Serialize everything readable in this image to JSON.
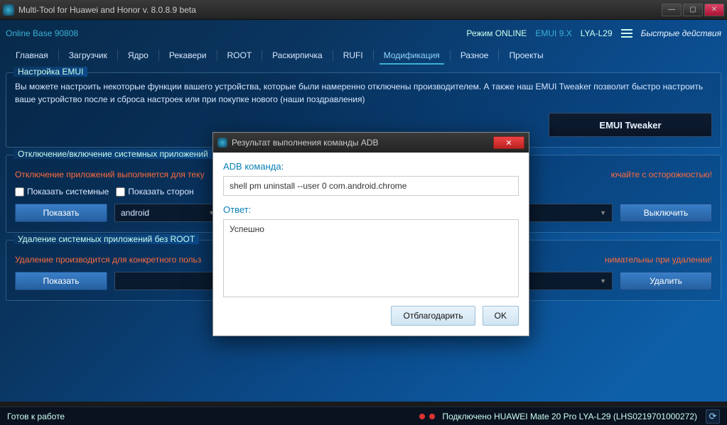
{
  "window": {
    "title": "Multi-Tool for Huawei and Honor v. 8.0.8.9 beta"
  },
  "header": {
    "online_base": "Online Base 90808",
    "mode_label": "Режим ONLINE",
    "emui": "EMUI 9.X",
    "device_short": "LYA-L29",
    "quick_actions": "Быстрые действия"
  },
  "tabs": [
    "Главная",
    "Загрузчик",
    "Ядро",
    "Рекавери",
    "ROOT",
    "Раскирпичка",
    "RUFI",
    "Модификация",
    "Разное",
    "Проекты"
  ],
  "active_tab_index": 7,
  "emui_panel": {
    "title": "Настройка EMUI",
    "desc": "Вы можете настроить некоторые функции вашего устройства, которые были намеренно отключены производителем. А также наш EMUI Tweaker позволит быстро настроить ваше устройство после и сброса настроек или при покупке нового (наши поздравления)",
    "tweaker_btn": "EMUI Tweaker"
  },
  "apps_panel": {
    "title": "Отключение/включение системных приложений",
    "warn_left": "Отключение приложений выполняется для теку",
    "warn_right": "ючайте с осторожностью!",
    "chk_system": "Показать системные",
    "chk_third": "Показать сторон",
    "btn_show": "Показать",
    "combo_value": "android",
    "btn_disable": "Выключить"
  },
  "delete_panel": {
    "title": "Удаление системных приложений без ROOT",
    "warn_left": "Удаление производится для конкретного польз",
    "warn_right": "нимательны при удалении!",
    "btn_show": "Показать",
    "btn_delete": "Удалить"
  },
  "status": {
    "ready": "Готов к работе",
    "connected": "Подключено HUAWEI Mate 20 Pro LYA-L29 (LHS0219701000272)"
  },
  "modal": {
    "title": "Результат выполнения команды ADB",
    "adb_label": "ADB команда:",
    "adb_cmd": "shell pm uninstall --user 0 com.android.chrome",
    "answer_label": "Ответ:",
    "answer_text": "Успешно",
    "btn_thanks": "Отблагодарить",
    "btn_ok": "OK"
  }
}
